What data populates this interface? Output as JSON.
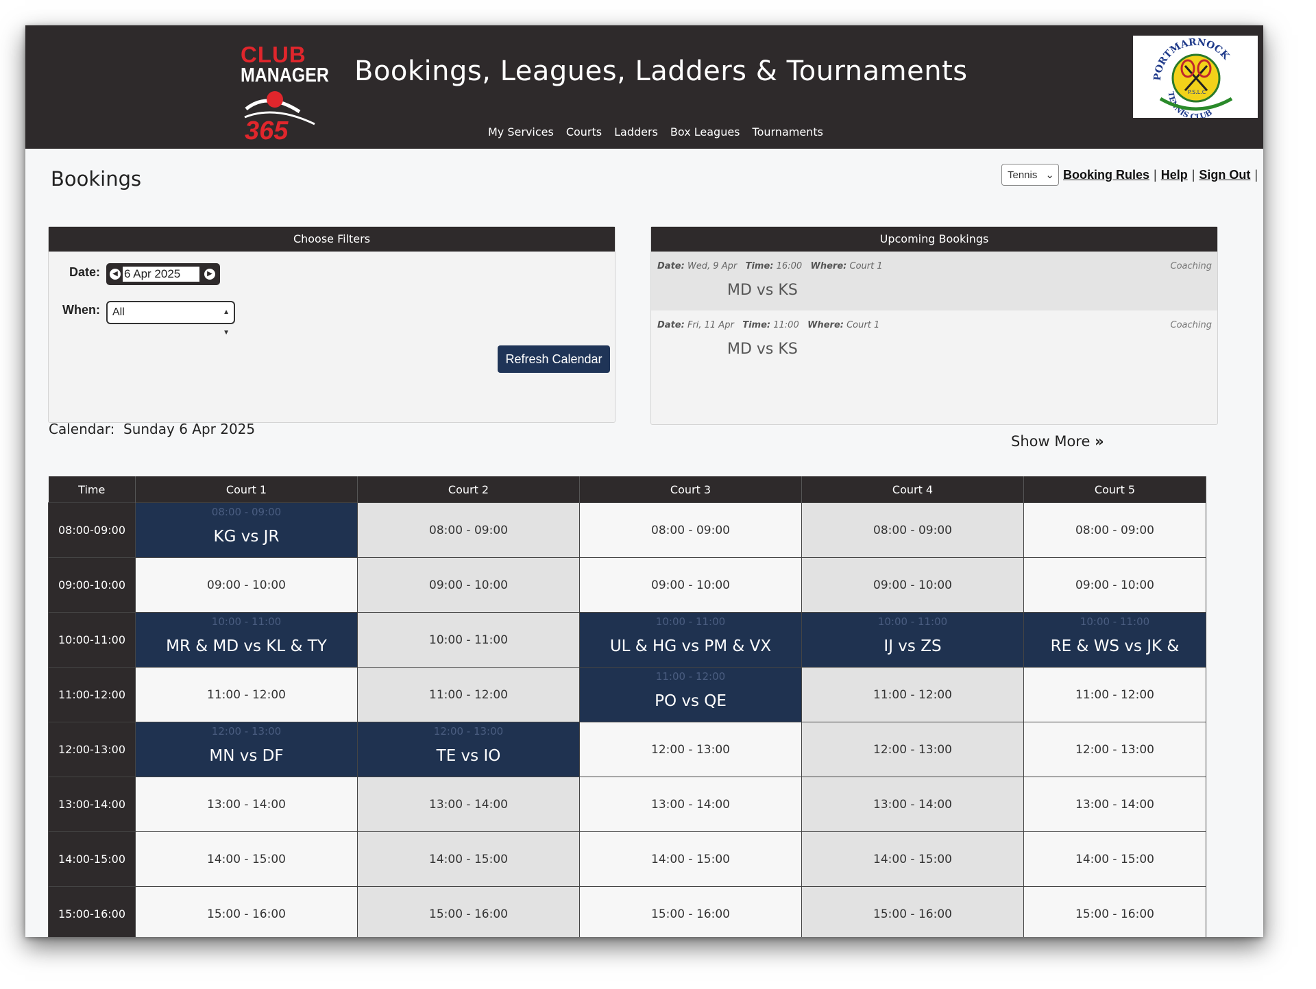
{
  "logo": {
    "line1": "CLUB",
    "line2": "MANAGER",
    "line3": "365",
    "colors": {
      "red": "#e0262c",
      "white": "#ffffff"
    }
  },
  "site_title": "Bookings, Leagues, Ladders & Tournaments",
  "nav": [
    "My Services",
    "Courts",
    "Ladders",
    "Box Leagues",
    "Tournaments"
  ],
  "club": {
    "text_top": "PORTMARNOCK",
    "text_mid": "P.S.L.C",
    "text_bottom": "TENNIS CLUB"
  },
  "page_title": "Bookings",
  "top_links": {
    "sport": "Tennis",
    "booking_rules": "Booking Rules",
    "help": "Help",
    "sign_out": "Sign Out",
    "separator": "|"
  },
  "filters": {
    "title": "Choose Filters",
    "date_label": "Date:",
    "date_value": "6 Apr 2025",
    "when_label": "When:",
    "when_value": "All",
    "refresh_label": "Refresh Calendar"
  },
  "upcoming": {
    "title": "Upcoming Bookings",
    "date_key": "Date:",
    "time_key": "Time:",
    "where_key": "Where:",
    "items": [
      {
        "date": "Wed, 9 Apr",
        "time": "16:00",
        "where": "Court 1",
        "type": "Coaching",
        "match": "MD vs KS"
      },
      {
        "date": "Fri, 11 Apr",
        "time": "11:00",
        "where": "Court 1",
        "type": "Coaching",
        "match": "MD vs KS"
      }
    ]
  },
  "calendar": {
    "label": "Calendar:",
    "date": "Sunday 6 Apr 2025",
    "show_more": "Show More"
  },
  "grid": {
    "headers": [
      "Time",
      "Court 1",
      "Court 2",
      "Court 3",
      "Court 4",
      "Court 5"
    ],
    "rows": [
      {
        "time": "08:00-09:00",
        "slot": "08:00 - 09:00"
      },
      {
        "time": "09:00-10:00",
        "slot": "09:00 - 10:00"
      },
      {
        "time": "10:00-11:00",
        "slot": "10:00 - 11:00"
      },
      {
        "time": "11:00-12:00",
        "slot": "11:00 - 12:00"
      },
      {
        "time": "12:00-13:00",
        "slot": "12:00 - 13:00"
      },
      {
        "time": "13:00-14:00",
        "slot": "13:00 - 14:00"
      },
      {
        "time": "14:00-15:00",
        "slot": "14:00 - 15:00"
      },
      {
        "time": "15:00-16:00",
        "slot": "15:00 - 16:00"
      }
    ],
    "bookings": {
      "r0c1": "KG vs JR",
      "r2c1": "MR & MD vs KL & TY",
      "r2c3": "UL & HG vs PM & VX",
      "r2c4": "IJ vs ZS",
      "r2c5": "RE & WS vs JK &",
      "r3c3": "PO vs QE",
      "r4c1": "MN vs DF",
      "r4c2": "TE vs IO"
    }
  },
  "colors": {
    "header_bg": "#2e2a2b",
    "booked_bg": "#1f3250",
    "button_bg": "#1f3457",
    "free_grey": "#e2e2e2",
    "free_light": "#f7f7f7"
  }
}
